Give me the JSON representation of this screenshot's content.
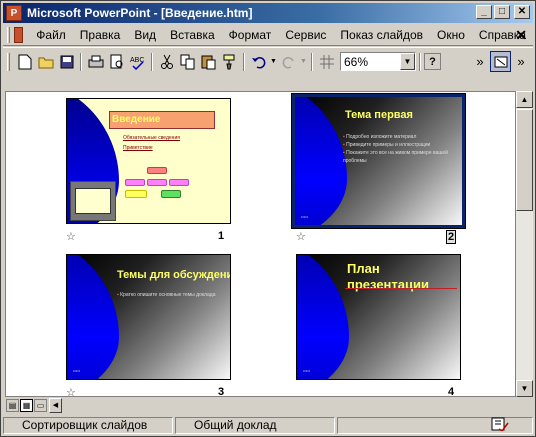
{
  "window": {
    "title": "Microsoft PowerPoint - [Введение.htm]",
    "buttons": {
      "minimize": "_",
      "maximize": "□",
      "close": "✕"
    }
  },
  "menu": {
    "items": [
      "Файл",
      "Правка",
      "Вид",
      "Вставка",
      "Формат",
      "Сервис",
      "Показ слайдов",
      "Окно",
      "Справка"
    ],
    "close": "✕"
  },
  "toolbar": {
    "icons": [
      "new-icon",
      "open-icon",
      "save-icon",
      "print-icon",
      "print-preview-icon",
      "spelling-icon",
      "cut-icon",
      "copy-icon",
      "paste-icon",
      "format-painter-icon",
      "undo-icon",
      "redo-icon",
      "grayscale-icon",
      "help-icon",
      "slide-miniature-icon"
    ],
    "zoom_value": "66%",
    "more": "»"
  },
  "slides": [
    {
      "number": "1",
      "title": "Введение",
      "bullets": [
        "Обязательные сведения",
        "Приветствие"
      ],
      "selected": false
    },
    {
      "number": "2",
      "title": "Тема первая",
      "bullets": [
        "Подробно изложите материал",
        "Приведите примеры и иллюстрации",
        "Покажите это все на живом примере вашей проблемы"
      ],
      "selected": true
    },
    {
      "number": "3",
      "title": "Темы для обсуждения",
      "bullets": [
        "Кратко опишите основные темы доклада"
      ],
      "selected": false
    },
    {
      "number": "4",
      "title": "План презентации",
      "bullets": [],
      "selected": false
    }
  ],
  "status": {
    "view": "Сортировщик слайдов",
    "design": "Общий доклад"
  }
}
